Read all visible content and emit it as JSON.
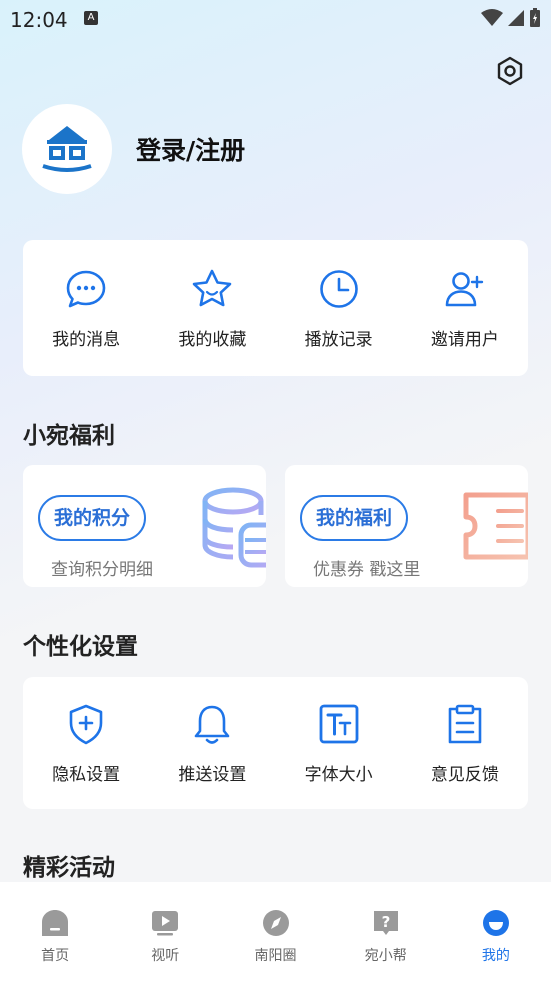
{
  "status": {
    "time": "12:04",
    "notif": "A"
  },
  "profile": {
    "login_label": "登录/注册"
  },
  "quick_actions": [
    {
      "label": "我的消息",
      "icon": "message-icon"
    },
    {
      "label": "我的收藏",
      "icon": "star-icon"
    },
    {
      "label": "播放记录",
      "icon": "clock-icon"
    },
    {
      "label": "邀请用户",
      "icon": "add-user-icon"
    }
  ],
  "benefits": {
    "title": "小宛福利",
    "points": {
      "label": "我的积分",
      "sub": "查询积分明细"
    },
    "welfare": {
      "label": "我的福利",
      "sub": "优惠券 戳这里"
    }
  },
  "settings": {
    "title": "个性化设置",
    "items": [
      {
        "label": "隐私设置",
        "icon": "shield-plus-icon"
      },
      {
        "label": "推送设置",
        "icon": "bell-icon"
      },
      {
        "label": "字体大小",
        "icon": "font-size-icon"
      },
      {
        "label": "意见反馈",
        "icon": "clipboard-icon"
      }
    ]
  },
  "activities": {
    "title": "精彩活动"
  },
  "tabs": [
    {
      "label": "首页",
      "icon": "home-icon"
    },
    {
      "label": "视听",
      "icon": "video-icon"
    },
    {
      "label": "南阳圈",
      "icon": "compass-icon"
    },
    {
      "label": "宛小帮",
      "icon": "help-icon"
    },
    {
      "label": "我的",
      "icon": "profile-icon"
    }
  ],
  "colors": {
    "accent": "#1e74e8",
    "text": "#222222",
    "muted": "#777777"
  }
}
